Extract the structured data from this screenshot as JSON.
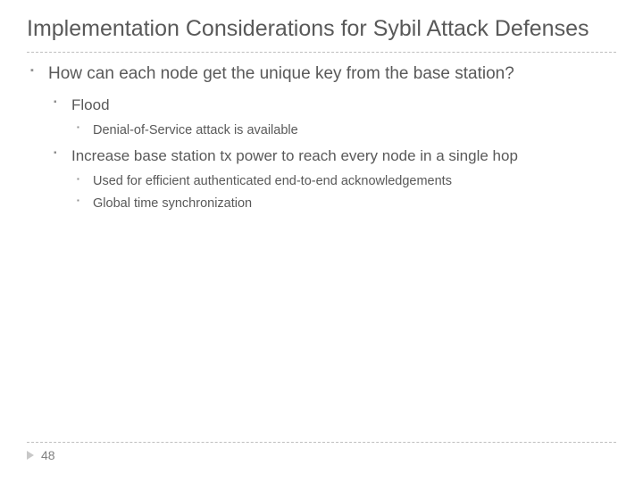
{
  "title": "Implementation Considerations for Sybil Attack Defenses",
  "bullets": {
    "l1": "How can each node get the unique key from the base station?",
    "l2a": "Flood",
    "l3a": "Denial-of-Service attack is available",
    "l2b": "Increase base station tx power to reach every node in a single hop",
    "l3b": "Used for efficient authenticated end-to-end acknowledgements",
    "l3c": "Global time synchronization"
  },
  "page_number": "48"
}
